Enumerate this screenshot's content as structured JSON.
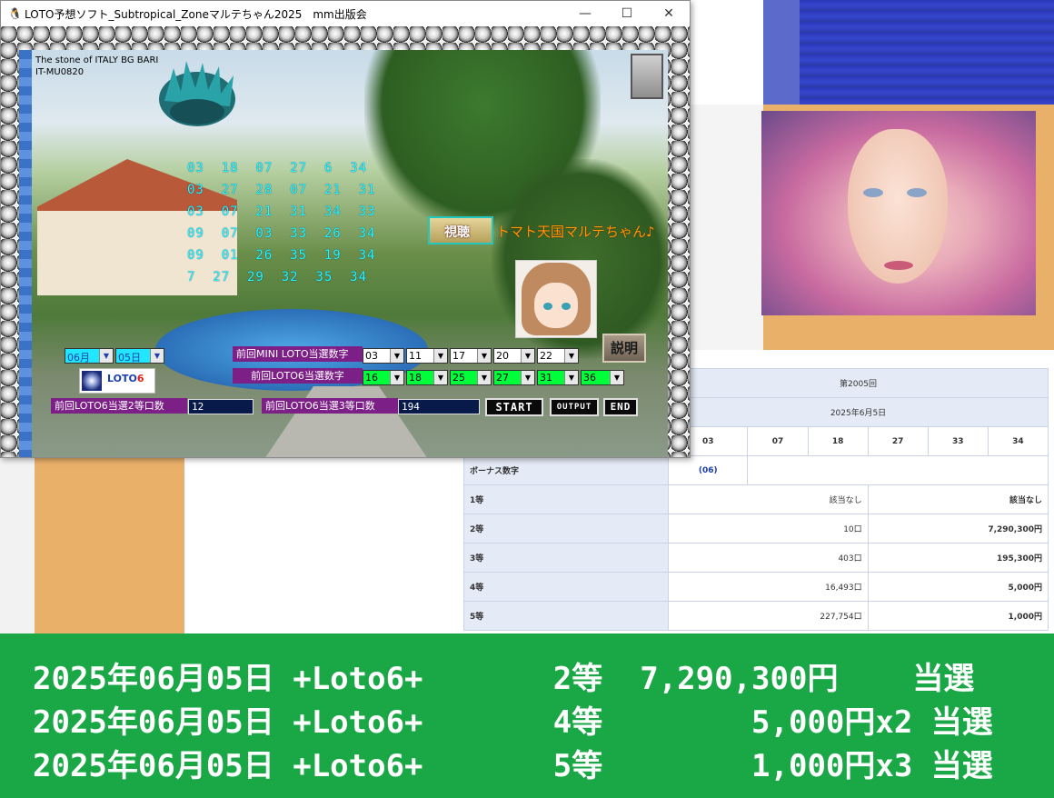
{
  "window": {
    "title": "LOTO予想ソフト_Subtropical_Zoneマルテちゃん2025　mm出版会",
    "minimize": "—",
    "maximize": "☐",
    "close": "✕"
  },
  "stone": {
    "line1": "The stone of ITALY  BG BARI",
    "line2": "IT-MU0820"
  },
  "predictions": [
    "03  18  07  27  6  34",
    "03  27  28  07  21  31",
    "03  07  21  31  34  33",
    "09  07  03  33  26  34",
    "09  01  26  35  19  34",
    "7  27  29  32  35  34"
  ],
  "view_button": "視聴",
  "tagline": "トマト天国マルテちゃん♪",
  "explain_button": "説明",
  "date": {
    "month": "06月",
    "day": "05日"
  },
  "mini_loto": {
    "label": "前回MINI LOTO当選数字",
    "numbers": [
      "03",
      "11",
      "17",
      "20",
      "22"
    ]
  },
  "loto6": {
    "label": "前回LOTO6当選数字",
    "numbers": [
      "16",
      "18",
      "25",
      "27",
      "31",
      "36"
    ]
  },
  "logo": {
    "text": "LOTO",
    "six": "6"
  },
  "second_prize": {
    "label": "前回LOTO6当選2等口数",
    "value": "12"
  },
  "third_prize": {
    "label": "前回LOTO6当選3等口数",
    "value": "194"
  },
  "buttons": {
    "start": "START",
    "output": "OUTPUT",
    "end": "END"
  },
  "result_table": {
    "round": "第2005回",
    "date": "2025年6月5日",
    "main_numbers": [
      "03",
      "07",
      "18",
      "27",
      "33",
      "34"
    ],
    "bonus_label": "ボーナス数字",
    "bonus": "(06)",
    "rows": [
      {
        "grade": "1等",
        "count": "該当なし",
        "amount": "該当なし"
      },
      {
        "grade": "2等",
        "count": "10口",
        "amount": "7,290,300円"
      },
      {
        "grade": "3等",
        "count": "403口",
        "amount": "195,300円"
      },
      {
        "grade": "4等",
        "count": "16,493口",
        "amount": "5,000円"
      },
      {
        "grade": "5等",
        "count": "227,754口",
        "amount": "1,000円"
      }
    ]
  },
  "banner": [
    "2025年06月05日 +Loto6+       2等  7,290,300円    当選",
    "2025年06月05日 +Loto6+       4等        5,000円x2 当選",
    "2025年06月05日 +Loto6+       5等        1,000円x3 当選"
  ]
}
